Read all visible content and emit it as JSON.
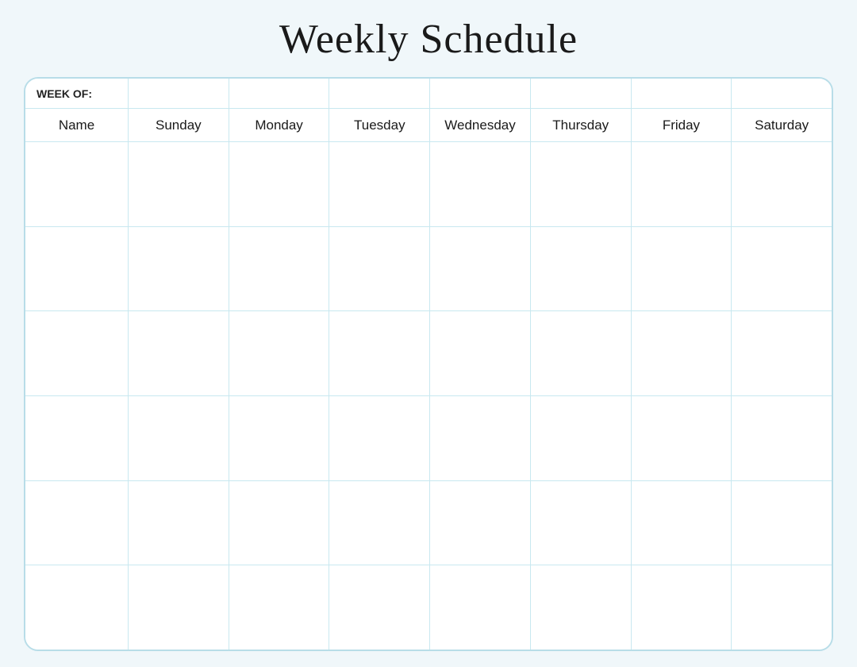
{
  "page": {
    "title": "Weekly Schedule",
    "week_of_label": "WEEK OF:",
    "colors": {
      "border": "#b8dde8",
      "grid_line": "#c8e8f0",
      "background": "#f0f7fa",
      "text": "#1a1a1a"
    }
  },
  "header": {
    "name_label": "Name",
    "days": [
      "Sunday",
      "Monday",
      "Tuesday",
      "Wednesday",
      "Thursday",
      "Friday",
      "Saturday"
    ]
  },
  "rows": [
    {
      "id": 1
    },
    {
      "id": 2
    },
    {
      "id": 3
    },
    {
      "id": 4
    },
    {
      "id": 5
    },
    {
      "id": 6
    }
  ]
}
